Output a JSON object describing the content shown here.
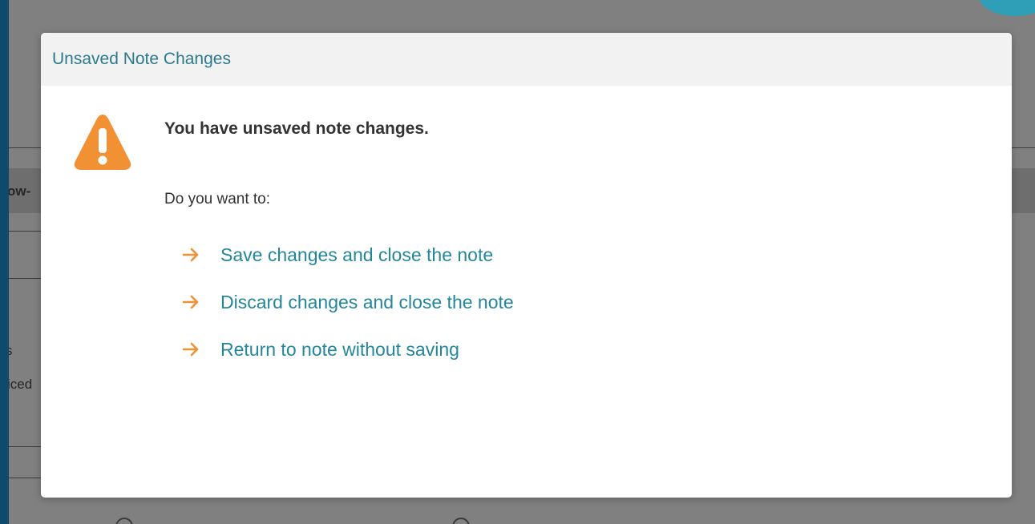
{
  "background": {
    "fragment_tab": "ow-",
    "fragment_left_1": "s",
    "fragment_left_2": "iced"
  },
  "dialog": {
    "title": "Unsaved Note Changes",
    "icon": "warning-triangle-icon",
    "message": "You have unsaved note changes.",
    "prompt": "Do you want to:",
    "options": [
      {
        "label": "Save changes and close the note",
        "icon": "arrow-right-icon"
      },
      {
        "label": "Discard changes and close the note",
        "icon": "arrow-right-icon"
      },
      {
        "label": "Return to note without saving",
        "icon": "arrow-right-icon"
      }
    ]
  },
  "colors": {
    "accent_teal": "#24869a",
    "warning_orange": "#f29034",
    "header_bg": "#f2f2f2",
    "page_edge": "#0d4a6b"
  }
}
